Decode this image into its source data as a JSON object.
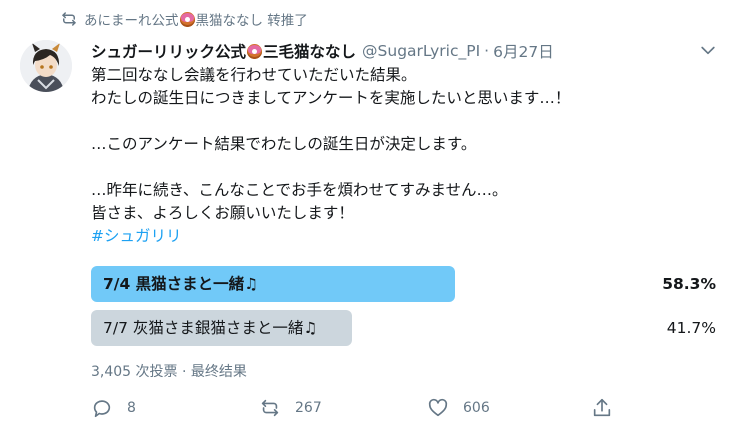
{
  "retweet": {
    "label_prefix": "あにまーれ公式",
    "label_suffix": "黒猫ななし 转推了"
  },
  "tweet": {
    "display_name_prefix": "シュガーリリック公式",
    "display_name_suffix": "三毛猫ななし",
    "handle": "@SugarLyric_PI",
    "separator": "·",
    "date": "6月27日",
    "lines": [
      "第二回ななし会議を行わせていただいた結果。",
      "わたしの誕生日につきましてアンケートを実施したいと思います…！",
      "",
      "…このアンケート結果でわたしの誕生日が決定します。",
      "",
      "…昨年に続き、こんなことでお手を煩わせてすみません…。",
      "皆さま、よろしくお願いいたします！"
    ],
    "hashtag": "#シュガリリ"
  },
  "poll": {
    "options": [
      {
        "label": "7/4 黒猫さまと一緒♫",
        "percent_text": "58.3%",
        "share": 0.583
      },
      {
        "label": "7/7 灰猫さま銀猫さまと一緒♫",
        "percent_text": "41.7%",
        "share": 0.417
      }
    ],
    "meta": "3,405 次投票 · 最终结果"
  },
  "actions": {
    "reply_count": "8",
    "retweet_count": "267",
    "like_count": "606"
  },
  "colors": {
    "winner_bar": "#71c9f8",
    "other_bar": "#ccd6dd",
    "link": "#1da1f2",
    "muted": "#657786"
  },
  "icons": [
    "retweet-icon",
    "donut-emoji-icon",
    "chevron-down-icon",
    "reply-icon",
    "like-icon",
    "share-icon"
  ]
}
